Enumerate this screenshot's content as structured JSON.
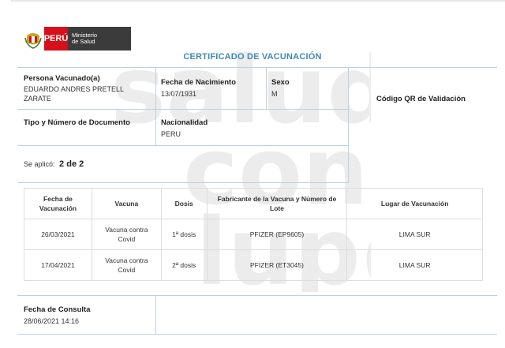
{
  "header": {
    "country": "PERÚ",
    "ministry_line1": "Ministerio",
    "ministry_line2": "de Salud",
    "title": "CERTIFICADO DE VACUNACIÓN"
  },
  "watermark": {
    "line1": "salud",
    "line2": "con",
    "line3": "lup@"
  },
  "person": {
    "name_label": "Persona Vacunado(a)",
    "name_line1": "EDUARDO ANDRES PRETELL",
    "name_line2": "ZARATE",
    "birth_label": "Fecha de Nacimiento",
    "birth_value": "13/07/1931",
    "sex_label": "Sexo",
    "sex_value": "M",
    "qr_label": "Código QR de Validación",
    "doc_label": "Tipo y Número de Documento",
    "nationality_label": "Nacionalidad",
    "nationality_value": "PERU",
    "applied_label": "Se aplicó:",
    "applied_value": "2 de 2"
  },
  "table": {
    "headers": [
      "Fecha de Vacunación",
      "Vacuna",
      "Dosis",
      "Fabricante de la Vacuna y Número de Lote",
      "Lugar de Vacunación"
    ],
    "rows": [
      {
        "date": "26/03/2021",
        "vaccine_line1": "Vacuna contra",
        "vaccine_line2": "Covid",
        "dose": "1ª dosis",
        "maker": "PFIZER (EP9605)",
        "place": "LIMA SUR"
      },
      {
        "date": "17/04/2021",
        "vaccine_line1": "Vacuna contra",
        "vaccine_line2": "Covid",
        "dose": "2ª dosis",
        "maker": "PFIZER (ET3045)",
        "place": "LIMA SUR"
      }
    ]
  },
  "footer": {
    "consult_label": "Fecha de Consulta",
    "consult_value": "28/06/2021 14:16"
  },
  "colors": {
    "title_blue": "#3f87b8",
    "peru_red": "#d5101a",
    "ministry_gray": "#3b3b3b",
    "grid_line": "#bcd0e0"
  }
}
